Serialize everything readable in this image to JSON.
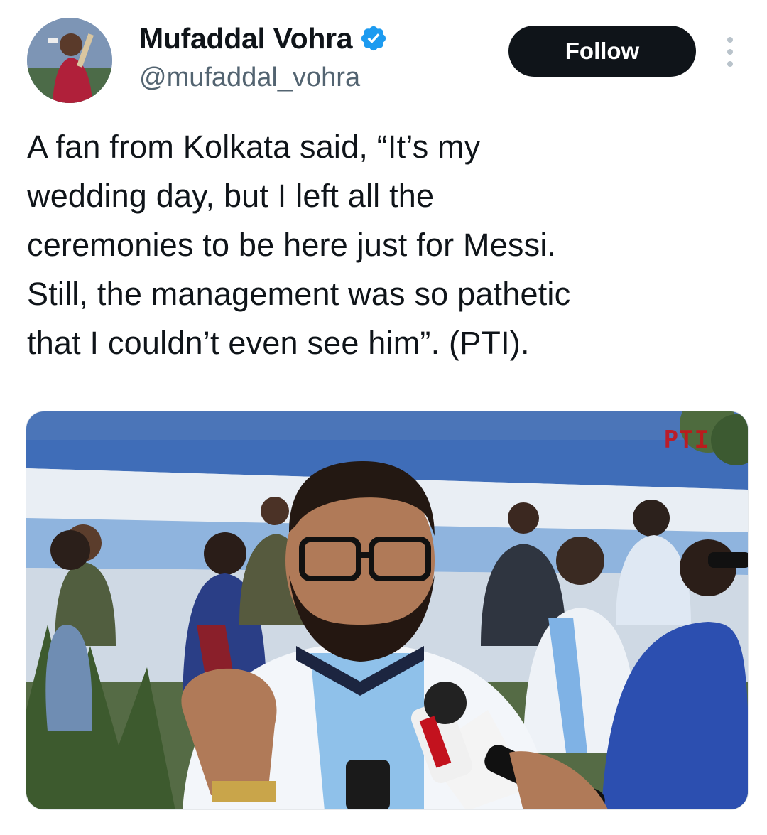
{
  "author": {
    "display_name": "Mufaddal Vohra",
    "handle": "@mufaddal_vohra",
    "verified": true,
    "verified_icon": "verified-badge-icon",
    "accent_color": "#1d9bf0"
  },
  "actions": {
    "follow_label": "Follow",
    "more_icon": "more-options-icon"
  },
  "tweet": {
    "text_lines": [
      "A fan from Kolkata said, “It’s my",
      "wedding day, but I left all the",
      "ceremonies to be here just for Messi.",
      "Still, the management was so pathetic",
      "that I couldn’t even see him”. (PTI)."
    ]
  },
  "media": {
    "watermark": "PTI"
  }
}
